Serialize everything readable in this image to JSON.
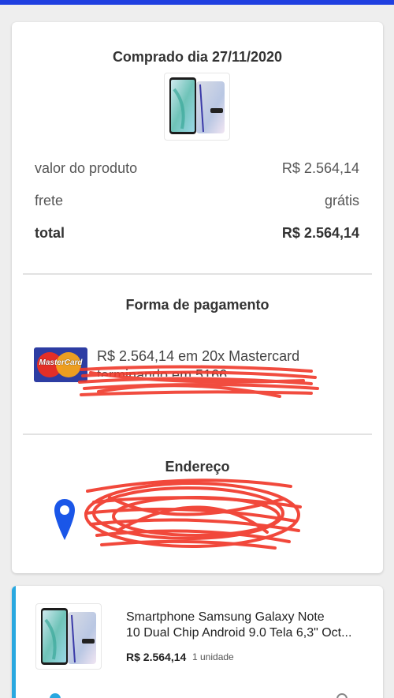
{
  "purchase": {
    "title": "Comprado dia 27/11/2020",
    "product_image": "phone-with-stylus-image"
  },
  "summary": {
    "value_label": "valor do produto",
    "value_amount": "R$ 2.564,14",
    "shipping_label": "frete",
    "shipping_value": "grátis",
    "total_label": "total",
    "total_value": "R$ 2.564,14"
  },
  "payment": {
    "title": "Forma de pagamento",
    "card_brand": "MasterCard",
    "description": "R$ 2.564,14 em 20x Mastercard",
    "card_ending_partial": "terminando em 5166"
  },
  "address": {
    "title": "Endereço",
    "icon": "location-pin-icon"
  },
  "item": {
    "name_line1": "Smartphone Samsung Galaxy Note",
    "name_line2": "10 Dual Chip Android 9.0 Tela 6,3\" Oct...",
    "price": "R$ 2.564,14",
    "quantity": "1 unidade"
  },
  "colors": {
    "top_bar": "#1f3fe0",
    "accent": "#29a8e0",
    "pin": "#1a56e8",
    "mastercard_bg": "#2d3da3"
  }
}
